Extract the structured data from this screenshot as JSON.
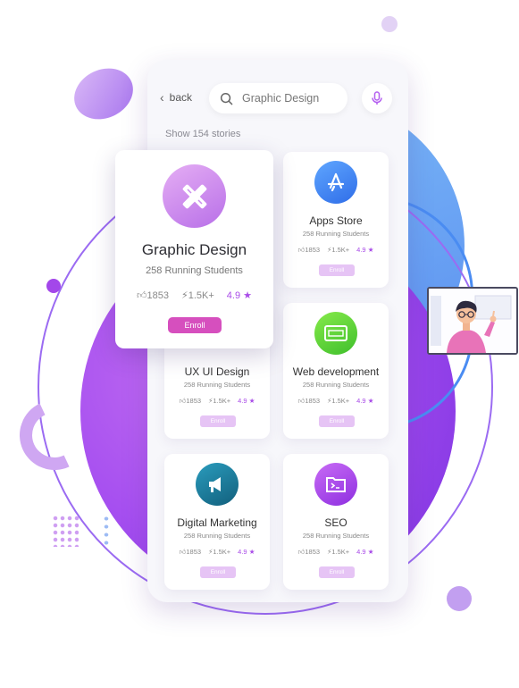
{
  "colors": {
    "accent": "#a94ce8",
    "enroll_featured": "#d64fbe",
    "enroll": "#e6c4f5",
    "apps_icon": "#3b82f0",
    "web_icon": "#5bd33d",
    "marketing_icon": "#1e7fa0",
    "seo_icon": "#a53fe8"
  },
  "topbar": {
    "back_label": "back",
    "search_value": "Graphic Design",
    "search_icon": "search-icon",
    "mic_icon": "microphone-icon"
  },
  "results_count": "Show 154 stories",
  "featured": {
    "icon": "pencil-ruler-icon",
    "title": "Graphic Design",
    "students": "258 Running Students",
    "likes": "1853",
    "views": "1.5K+",
    "rating": "4.9",
    "enroll_label": "Enroll"
  },
  "courses": [
    {
      "icon": "app-store-icon",
      "title": "Apps Store",
      "students": "258 Running Students",
      "likes": "1853",
      "views": "1.5K+",
      "rating": "4.9",
      "enroll_label": "Enroll"
    },
    {
      "icon": "design-icon",
      "title": "UX UI Design",
      "students": "258 Running Students",
      "likes": "1853",
      "views": "1.5K+",
      "rating": "4.9",
      "enroll_label": "Enroll"
    },
    {
      "icon": "browser-icon",
      "title": "Web development",
      "students": "258 Running Students",
      "likes": "1853",
      "views": "1.5K+",
      "rating": "4.9",
      "enroll_label": "Enroll"
    },
    {
      "icon": "megaphone-icon",
      "title": "Digital Marketing",
      "students": "258 Running Students",
      "likes": "1853",
      "views": "1.5K+",
      "rating": "4.9",
      "enroll_label": "Enroll"
    },
    {
      "icon": "terminal-folder-icon",
      "title": "SEO",
      "students": "258 Running Students",
      "likes": "1853",
      "views": "1.5K+",
      "rating": "4.9",
      "enroll_label": "Enroll"
    }
  ]
}
